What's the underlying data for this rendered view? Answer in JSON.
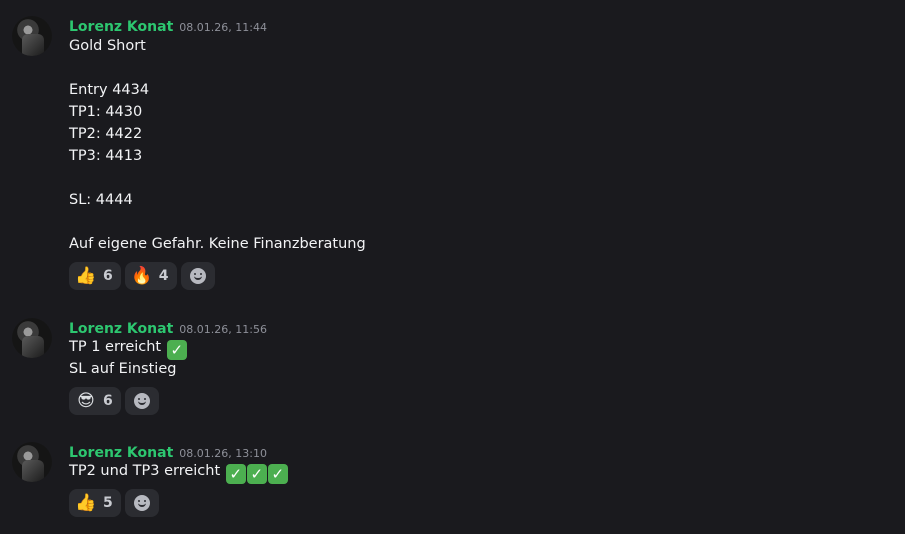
{
  "messages": [
    {
      "author": "Lorenz Konat",
      "time": "08.01.26, 11:44",
      "lines": [
        "Gold Short",
        "Entry 4434",
        "TP1: 4430",
        "TP2: 4422",
        "TP3: 4413",
        "SL: 4444",
        "Auf eigene Gefahr. Keine Finanzberatung"
      ],
      "reactions": [
        {
          "emoji": "👍",
          "count": "6"
        },
        {
          "emoji": "🔥",
          "count": "4"
        }
      ]
    },
    {
      "author": "Lorenz Konat",
      "time": "08.01.26, 11:56",
      "lines": [
        "TP 1 erreicht",
        "SL auf Einstieg"
      ],
      "check": "✓",
      "reactions": [
        {
          "emoji": "😎",
          "count": "6"
        }
      ]
    },
    {
      "author": "Lorenz Konat",
      "time": "08.01.26, 13:10",
      "lines": [
        "TP2 und TP3 erreicht"
      ],
      "check": "✓",
      "reactions": [
        {
          "emoji": "👍",
          "count": "5"
        }
      ]
    }
  ],
  "colors": {
    "author": "#2dc770",
    "background": "#1a1a1e",
    "check": "#4caf50"
  },
  "icons": {
    "add_reaction": "smiley-icon"
  }
}
